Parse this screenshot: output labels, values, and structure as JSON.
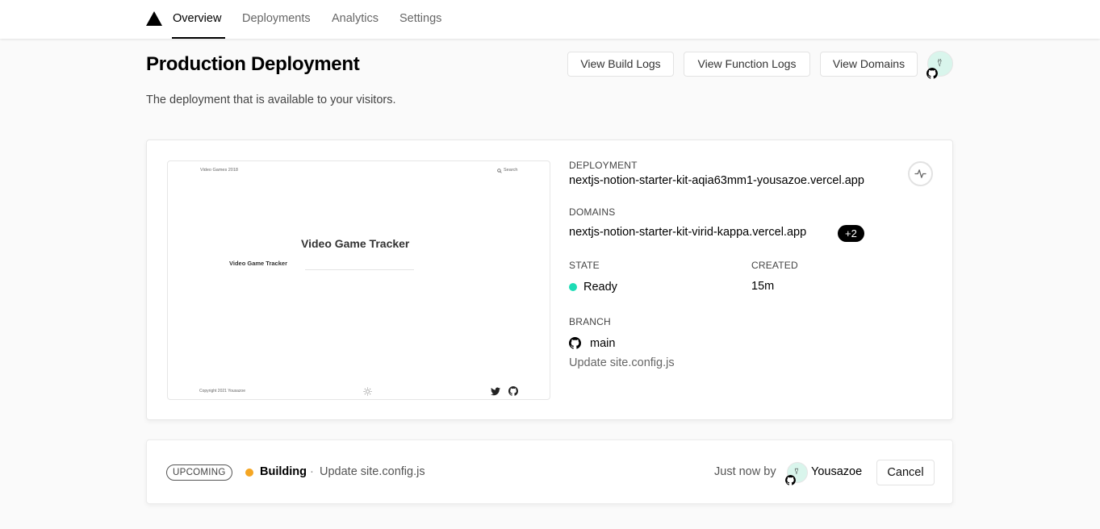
{
  "nav": {
    "tabs": [
      {
        "label": "Overview",
        "active": true
      },
      {
        "label": "Deployments"
      },
      {
        "label": "Analytics"
      },
      {
        "label": "Settings"
      }
    ]
  },
  "header": {
    "title": "Production Deployment",
    "subtitle": "The deployment that is available to your visitors.",
    "buttons": [
      "View Build Logs",
      "View Function Logs",
      "View Domains"
    ]
  },
  "preview": {
    "site_name": "Video Games 2018",
    "search": "Search",
    "title": "Video Game Tracker",
    "sidebar_title": "Video Game Tracker",
    "footer": "Copyright 2021 Yousazoe"
  },
  "deployment": {
    "deployment_label": "DEPLOYMENT",
    "deployment_url": "nextjs-notion-starter-kit-aqia63mm1-yousazoe.vercel.app",
    "domains_label": "DOMAINS",
    "domain": "nextjs-notion-starter-kit-virid-kappa.vercel.app",
    "domain_extra": "+2",
    "state_label": "STATE",
    "state": "Ready",
    "created_label": "CREATED",
    "created": "15m",
    "branch_label": "BRANCH",
    "branch": "main",
    "commit": "Update site.config.js"
  },
  "upcoming": {
    "tag": "UPCOMING",
    "status": "Building",
    "separator": "·",
    "commit": "Update site.config.js",
    "time": "Just now by",
    "author": "Yousazoe",
    "cancel": "Cancel"
  },
  "colors": {
    "ready": "#1ddcb5",
    "building": "#f5a623"
  }
}
